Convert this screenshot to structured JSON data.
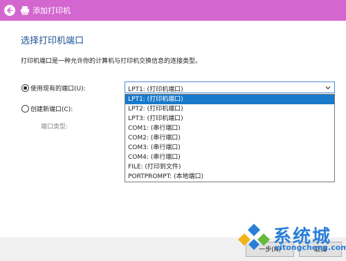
{
  "window": {
    "title": "添加打印机",
    "accent": "#d466cf"
  },
  "page": {
    "heading": "选择打印机端口",
    "description": "打印机端口是一种允许你的计算机与打印机交换信息的连接类型。"
  },
  "options": {
    "use_existing_label": "使用现有的端口(U):",
    "use_existing_checked": true,
    "create_new_label": "创建新端口(C):",
    "create_new_checked": false,
    "port_type_label": "端口类型:"
  },
  "port_select": {
    "value": "LPT1: (打印机端口)",
    "options": [
      "LPT1: (打印机端口)",
      "LPT2: (打印机端口)",
      "LPT3: (打印机端口)",
      "COM1: (串行端口)",
      "COM2: (串行端口)",
      "COM3: (串行端口)",
      "COM4: (串行端口)",
      "FILE: (打印到文件)",
      "PORTPROMPT: (本地端口)"
    ],
    "selected_index": 0
  },
  "footer": {
    "next_label": "一步(N)",
    "cancel_label": "取消"
  },
  "watermark": {
    "text": "系统城",
    "url": "xitongcheng.com"
  },
  "icons": {
    "back": "back-arrow-icon",
    "printer": "printer-icon",
    "dropdown": "chevron-down-icon"
  }
}
